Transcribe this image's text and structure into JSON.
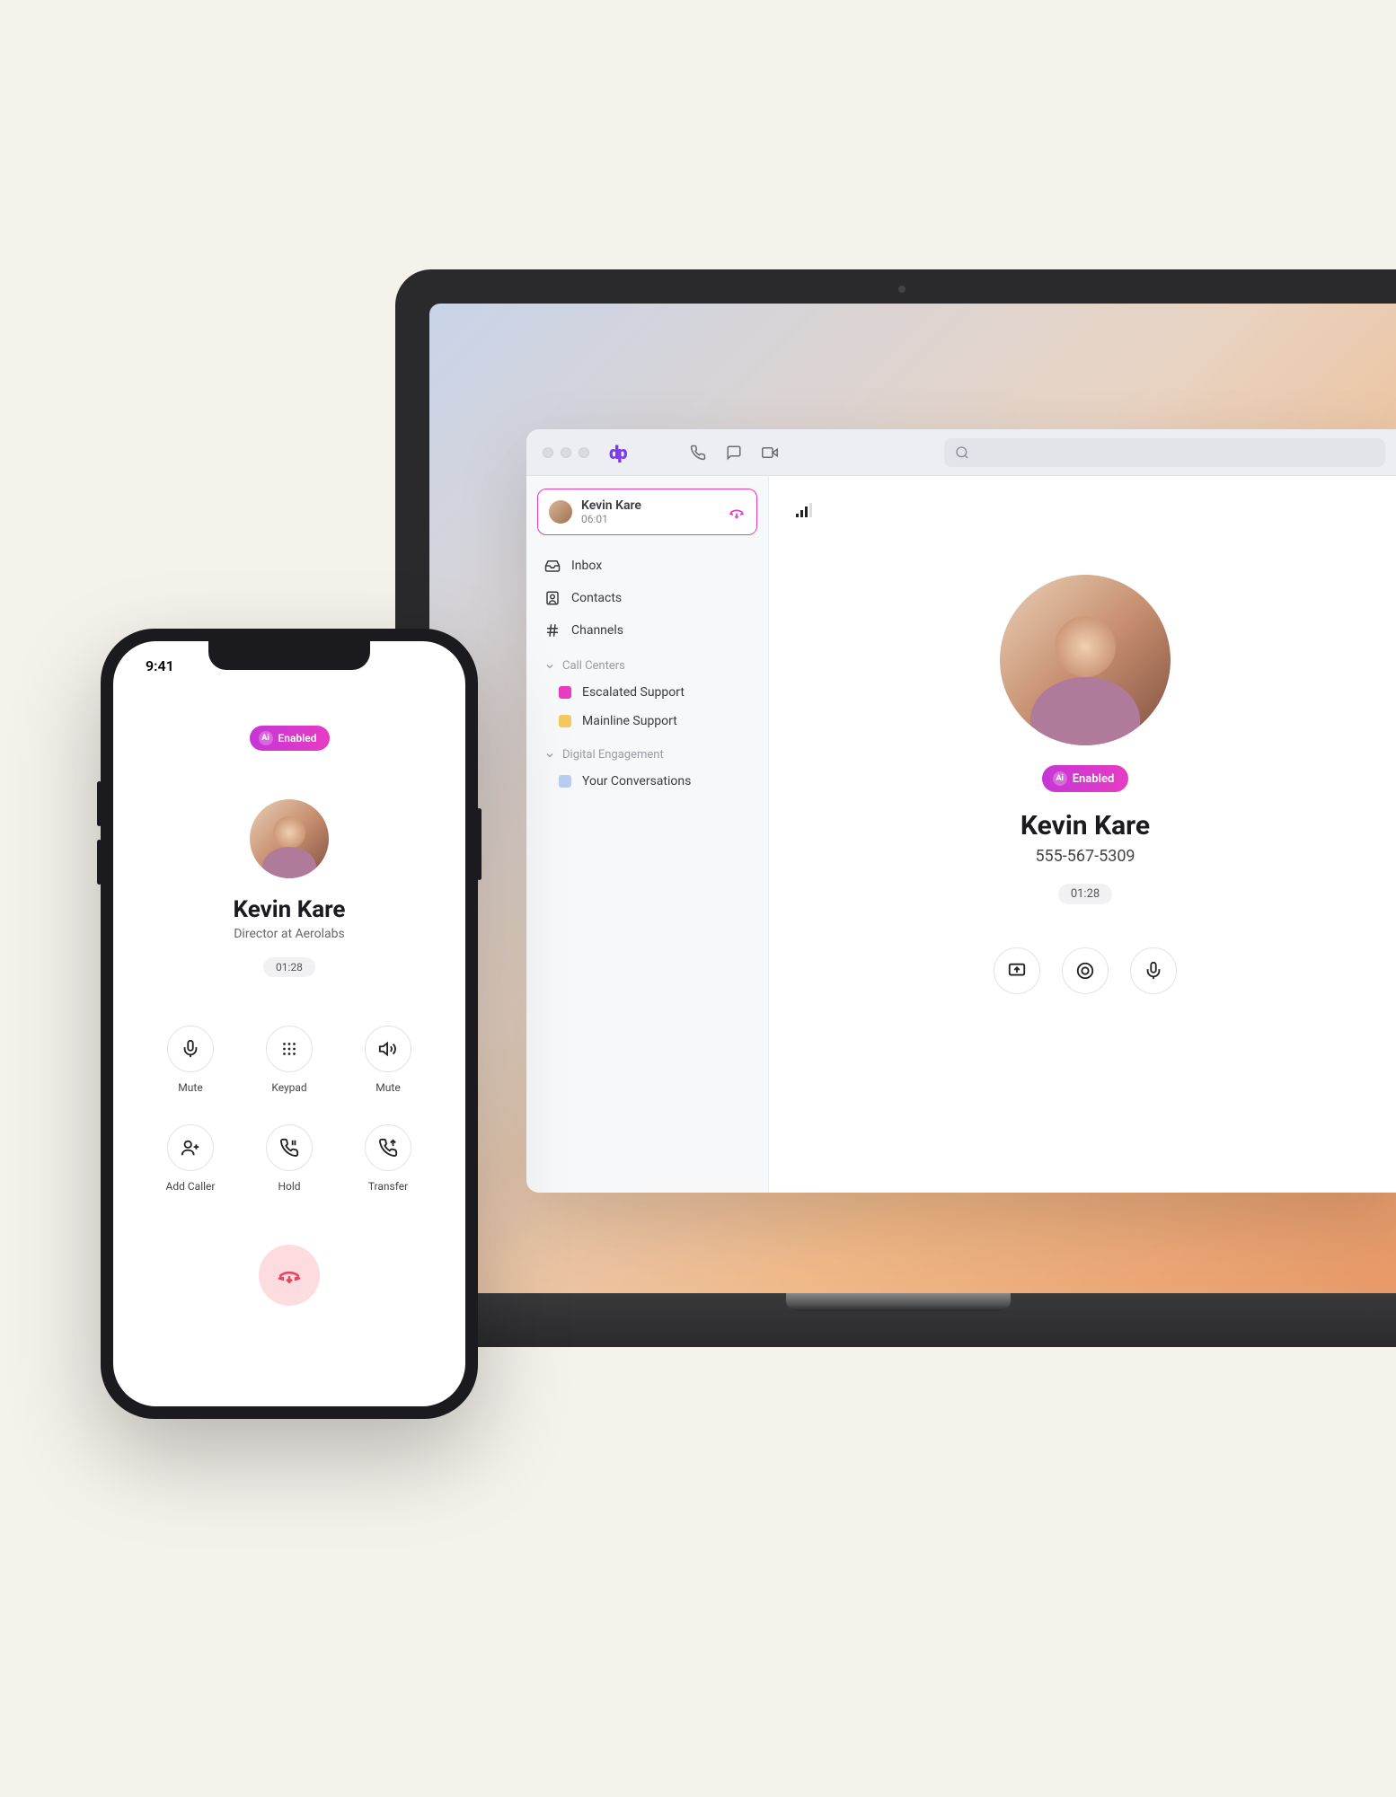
{
  "phone": {
    "status_time": "9:41",
    "enabled_label": "Enabled",
    "caller_name": "Kevin Kare",
    "caller_subtitle": "Director at Aerolabs",
    "timer": "01:28",
    "controls": [
      {
        "label": "Mute"
      },
      {
        "label": "Keypad"
      },
      {
        "label": "Mute"
      },
      {
        "label": "Add Caller"
      },
      {
        "label": "Hold"
      },
      {
        "label": "Transfer"
      }
    ]
  },
  "desktop": {
    "active_call": {
      "name": "Kevin Kare",
      "timer": "06:01"
    },
    "nav": {
      "inbox": "Inbox",
      "contacts": "Contacts",
      "channels": "Channels"
    },
    "call_centers_header": "Call Centers",
    "call_centers": [
      {
        "label": "Escalated Support",
        "color": "#e73cc2"
      },
      {
        "label": "Mainline Support",
        "color": "#f4c95d"
      }
    ],
    "digital_header": "Digital Engagement",
    "digital_items": [
      {
        "label": "Your Conversations",
        "color": "#b8cdf0"
      }
    ],
    "call": {
      "enabled_label": "Enabled",
      "name": "Kevin Kare",
      "phone": "555-567-5309",
      "timer": "01:28"
    }
  }
}
